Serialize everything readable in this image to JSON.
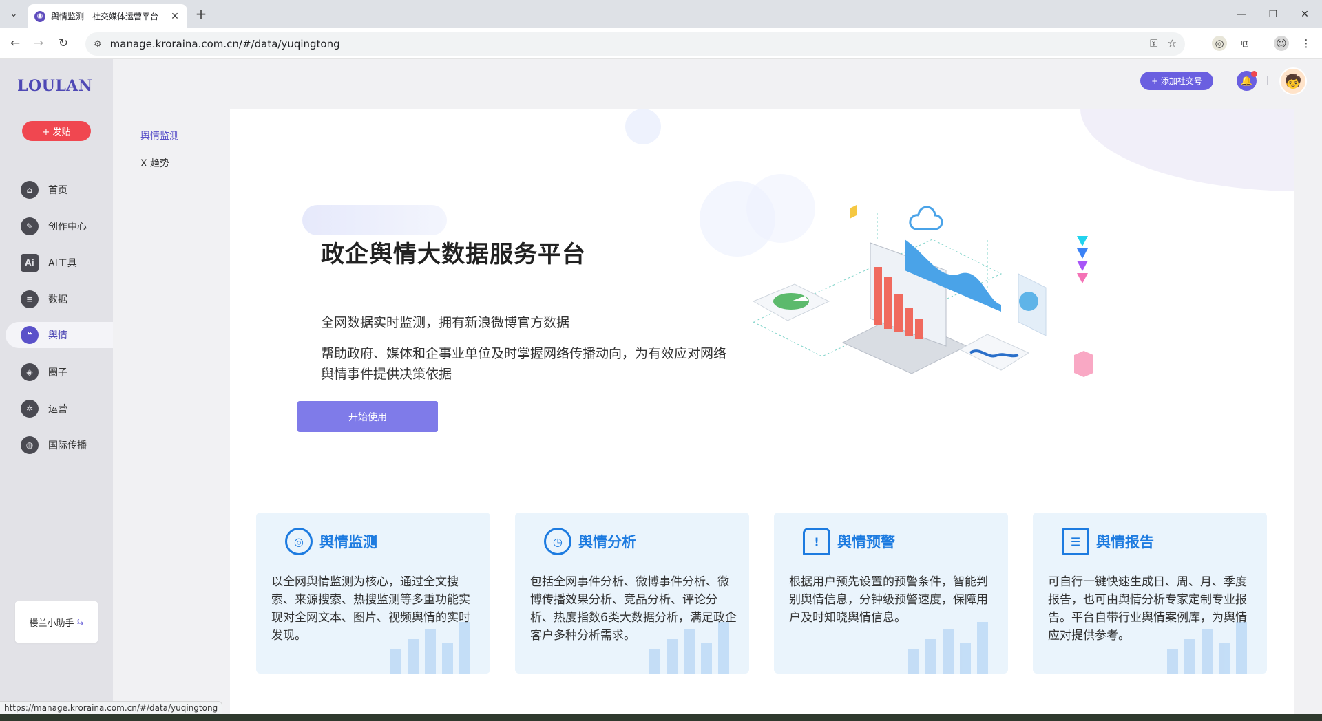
{
  "browser": {
    "tab_title": "舆情监测 - 社交媒体运营平台",
    "url": "manage.kroraina.com.cn/#/data/yuqingtong",
    "status_url": "https://manage.kroraina.com.cn/#/data/yuqingtong"
  },
  "sidebar": {
    "logo": "LOULAN",
    "post_button": "+ 发贴",
    "items": [
      {
        "label": "首页",
        "icon": "home-icon"
      },
      {
        "label": "创作中心",
        "icon": "palette-icon"
      },
      {
        "label": "AI工具",
        "icon": "ai-icon"
      },
      {
        "label": "数据",
        "icon": "database-icon"
      },
      {
        "label": "舆情",
        "icon": "quote-icon"
      },
      {
        "label": "圈子",
        "icon": "compass-icon"
      },
      {
        "label": "运营",
        "icon": "network-icon"
      },
      {
        "label": "国际传播",
        "icon": "globe-icon"
      }
    ],
    "assistant": "楼兰小助手"
  },
  "submenu": {
    "items": [
      "舆情监测",
      "X 趋势"
    ]
  },
  "header": {
    "add_social": "+ 添加社交号"
  },
  "hero": {
    "title": "政企舆情大数据服务平台",
    "line1": "全网数据实时监测，拥有新浪微博官方数据",
    "line2": "帮助政府、媒体和企事业单位及时掌握网络传播动向，为有效应对网络舆情事件提供决策依据",
    "button": "开始使用"
  },
  "features": [
    {
      "title": "舆情监测",
      "icon": "target-icon",
      "desc": "以全网舆情监测为核心，通过全文搜索、来源搜索、热搜监测等多重功能实现对全网文本、图片、视频舆情的实时发现。"
    },
    {
      "title": "舆情分析",
      "icon": "clock-chart-icon",
      "desc": "包括全网事件分析、微博事件分析、微博传播效果分析、竞品分析、评论分析、热度指数6类大数据分析，满足政企客户多种分析需求。"
    },
    {
      "title": "舆情预警",
      "icon": "alarm-icon",
      "desc": "根据用户预先设置的预警条件，智能判别舆情信息，分钟级预警速度，保障用户及时知晓舆情信息。"
    },
    {
      "title": "舆情报告",
      "icon": "report-icon",
      "desc": "可自行一键快速生成日、周、月、季度报告，也可由舆情分析专家定制专业报告。平台自带行业舆情案例库，为舆情应对提供参考。"
    }
  ],
  "colors": {
    "brand": "#4f49b5",
    "accent": "#6a5fe0",
    "post": "#f04750",
    "feature_blue": "#1d7be0"
  }
}
